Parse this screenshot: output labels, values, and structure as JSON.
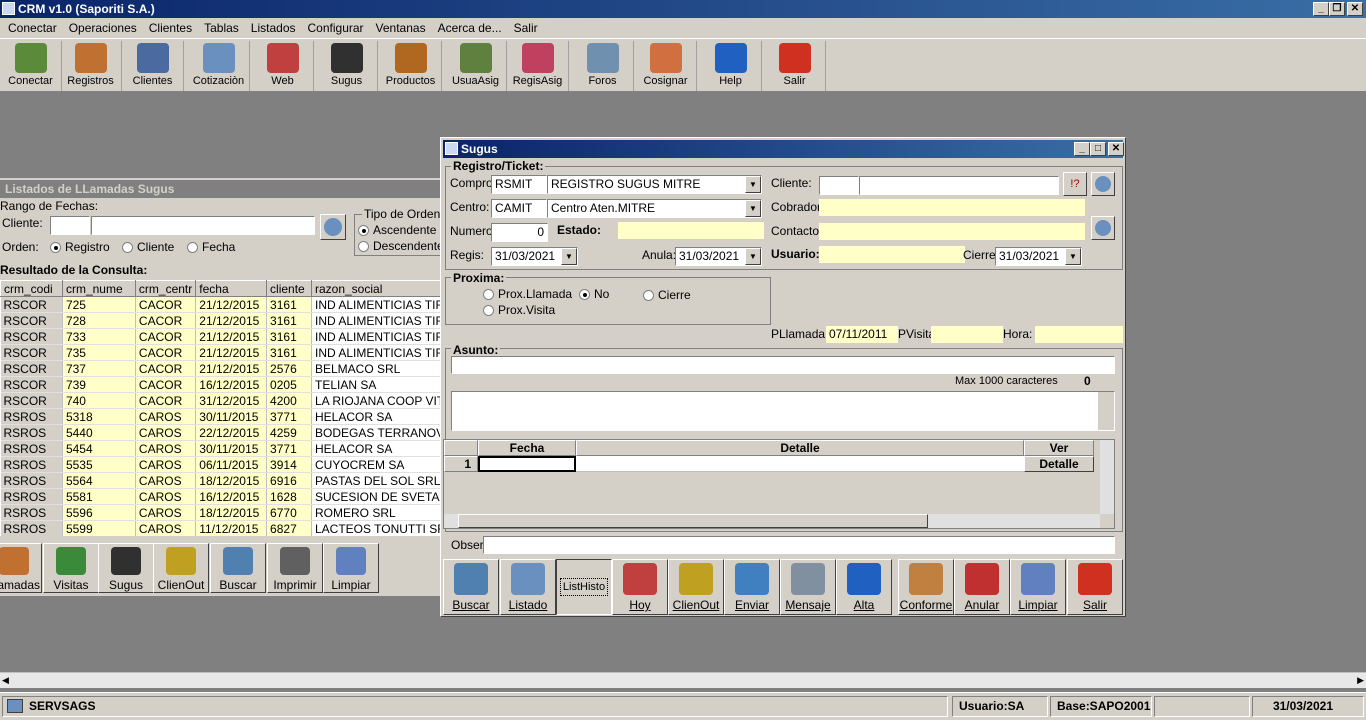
{
  "window": {
    "title": "CRM v1.0 (Saporiti S.A.)"
  },
  "menu": [
    "Conectar",
    "Operaciones",
    "Clientes",
    "Tablas",
    "Listados",
    "Configurar",
    "Ventanas",
    "Acerca de...",
    "Salir"
  ],
  "toolbar": [
    {
      "label": "Conectar",
      "icon": "connect-icon",
      "color": "#5a8a3a"
    },
    {
      "label": "Registros",
      "icon": "headset-user-icon",
      "color": "#c07030"
    },
    {
      "label": "Clientes",
      "icon": "user-icon",
      "color": "#4a6aa0"
    },
    {
      "label": "Cotizaciòn",
      "icon": "document-icon",
      "color": "#6a90c0"
    },
    {
      "label": "Web",
      "icon": "calendar-icon",
      "color": "#c04040"
    },
    {
      "label": "Sugus",
      "icon": "agent-icon",
      "color": "#303030"
    },
    {
      "label": "Productos",
      "icon": "briefcase-icon",
      "color": "#b06820"
    },
    {
      "label": "UsuaAsig",
      "icon": "users-icon",
      "color": "#608040"
    },
    {
      "label": "RegisAsig",
      "icon": "checklist-icon",
      "color": "#c04060"
    },
    {
      "label": "Foros",
      "icon": "forum-icon",
      "color": "#7090b0"
    },
    {
      "label": "Cosignar",
      "icon": "assign-user-icon",
      "color": "#d07040"
    },
    {
      "label": "Help",
      "icon": "help-icon",
      "color": "#2060c0"
    },
    {
      "label": "Salir",
      "icon": "power-icon",
      "color": "#d03020"
    }
  ],
  "listados": {
    "title": "Listados de LLamadas Sugus",
    "rango_label": "Rango de Fechas:",
    "cliente_label": "Cliente:",
    "orden_label": "Orden:",
    "orden_options": [
      "Registro",
      "Cliente",
      "Fecha"
    ],
    "tipo_orden_label": "Tipo de Orden",
    "tipo_options": [
      "Ascendente",
      "Descendente"
    ],
    "resultado_label": "Resultado de la Consulta:",
    "columns": [
      "crm_codi",
      "crm_nume",
      "crm_centr",
      "fecha",
      "cliente",
      "razon_social"
    ],
    "rows": [
      [
        "RSCOR",
        "725",
        "CACOR",
        "21/12/2015",
        "3161",
        "IND ALIMENTICIAS TIRA"
      ],
      [
        "RSCOR",
        "728",
        "CACOR",
        "21/12/2015",
        "3161",
        "IND ALIMENTICIAS TIRA"
      ],
      [
        "RSCOR",
        "733",
        "CACOR",
        "21/12/2015",
        "3161",
        "IND ALIMENTICIAS TIRA"
      ],
      [
        "RSCOR",
        "735",
        "CACOR",
        "21/12/2015",
        "3161",
        "IND ALIMENTICIAS TIRA"
      ],
      [
        "RSCOR",
        "737",
        "CACOR",
        "21/12/2015",
        "2576",
        "BELMACO SRL"
      ],
      [
        "RSCOR",
        "739",
        "CACOR",
        "16/12/2015",
        "0205",
        "TELIAN SA"
      ],
      [
        "RSCOR",
        "740",
        "CACOR",
        "31/12/2015",
        "4200",
        "LA RIOJANA COOP VIT D"
      ],
      [
        "RSROS",
        "5318",
        "CAROS",
        "30/11/2015",
        "3771",
        "HELACOR SA"
      ],
      [
        "RSROS",
        "5440",
        "CAROS",
        "22/12/2015",
        "4259",
        "BODEGAS TERRANOVA"
      ],
      [
        "RSROS",
        "5454",
        "CAROS",
        "30/11/2015",
        "3771",
        "HELACOR SA"
      ],
      [
        "RSROS",
        "5535",
        "CAROS",
        "06/11/2015",
        "3914",
        "CUYOCREM SA"
      ],
      [
        "RSROS",
        "5564",
        "CAROS",
        "18/12/2015",
        "6916",
        "PASTAS DEL SOL SRL"
      ],
      [
        "RSROS",
        "5581",
        "CAROS",
        "16/12/2015",
        "1628",
        "SUCESION DE SVETAZ I"
      ],
      [
        "RSROS",
        "5596",
        "CAROS",
        "18/12/2015",
        "6770",
        "ROMERO SRL"
      ],
      [
        "RSROS",
        "5599",
        "CAROS",
        "11/12/2015",
        "6827",
        "LACTEOS TONUTTI SRL"
      ]
    ],
    "buttons": [
      {
        "label": "Llamadas",
        "icon": "headset-user-icon",
        "color": "#c07030"
      },
      {
        "label": "Visitas",
        "icon": "add-user-icon",
        "color": "#3a8a3a"
      },
      {
        "label": "Sugus",
        "icon": "agent-icon",
        "color": "#303030"
      },
      {
        "label": "ClienOut",
        "icon": "lock-user-icon",
        "color": "#c0a020"
      },
      {
        "label": "Buscar",
        "icon": "magnifier-icon",
        "color": "#5080b0"
      },
      {
        "label": "Imprimir",
        "icon": "printer-icon",
        "color": "#606060"
      },
      {
        "label": "Limpiar",
        "icon": "trash-icon",
        "color": "#6080c0"
      }
    ]
  },
  "sugus": {
    "title": "Sugus",
    "registro_label": "Registro/Ticket:",
    "compro_label": "Compro:",
    "compro_code": "RSMIT",
    "compro_desc": "REGISTRO SUGUS MITRE",
    "centro_label": "Centro:",
    "centro_code": "CAMIT",
    "centro_desc": "Centro Aten.MITRE",
    "numero_label": "Numero:",
    "numero_value": "0",
    "estado_label": "Estado:",
    "regis_label": "Regis:",
    "regis_value": "31/03/2021",
    "anula_label": "Anula:",
    "anula_value": "31/03/2021",
    "cliente_label": "Cliente:",
    "cobrador_label": "Cobrador:",
    "contacto_label": "Contacto:",
    "usuario_label": "Usuario:",
    "cierre_label": "Cierre:",
    "cierre_value": "31/03/2021",
    "proxima_label": "Proxima:",
    "proxima_options": [
      "Prox.Llamada",
      "No",
      "Cierre",
      "Prox.Visita"
    ],
    "pllamada_label": "PLlamada:",
    "pllamada_value": "07/11/2011",
    "pvisita_label": "PVisita",
    "hora_label": "Hora:",
    "asunto_label": "Asunto:",
    "max_label": "Max 1000 caracteres",
    "max_count": "0",
    "grid_columns": [
      "Fecha",
      "Detalle",
      "Ver"
    ],
    "grid_row_num": "1",
    "grid_row_button": "Detalle",
    "obser_label": "Obser:",
    "list_histo": "ListHisto",
    "buttons": [
      {
        "label": "Buscar",
        "icon": "magnifier-icon",
        "color": "#5080b0"
      },
      {
        "label": "Listado",
        "icon": "document-icon",
        "color": "#6a90c0"
      },
      {
        "label": "Hoy",
        "icon": "calendar-icon",
        "color": "#c04040"
      },
      {
        "label": "ClienOut",
        "icon": "lock-user-icon",
        "color": "#c0a020"
      },
      {
        "label": "Enviar",
        "icon": "send-icon",
        "color": "#4080c0"
      },
      {
        "label": "Mensaje",
        "icon": "message-icon",
        "color": "#8090a0"
      },
      {
        "label": "Alta",
        "icon": "add-db-icon",
        "color": "#2060c0"
      },
      {
        "label": "Conforme",
        "icon": "handshake-icon",
        "color": "#c08040"
      },
      {
        "label": "Anular",
        "icon": "delete-db-icon",
        "color": "#c03030"
      },
      {
        "label": "Limpiar",
        "icon": "trash-icon",
        "color": "#6080c0"
      },
      {
        "label": "Salir",
        "icon": "power-icon",
        "color": "#d03020"
      }
    ]
  },
  "status": {
    "server": "SERVSAGS",
    "usuario": "Usuario:SA",
    "base": "Base:SAPO2001",
    "date": "31/03/2021"
  }
}
